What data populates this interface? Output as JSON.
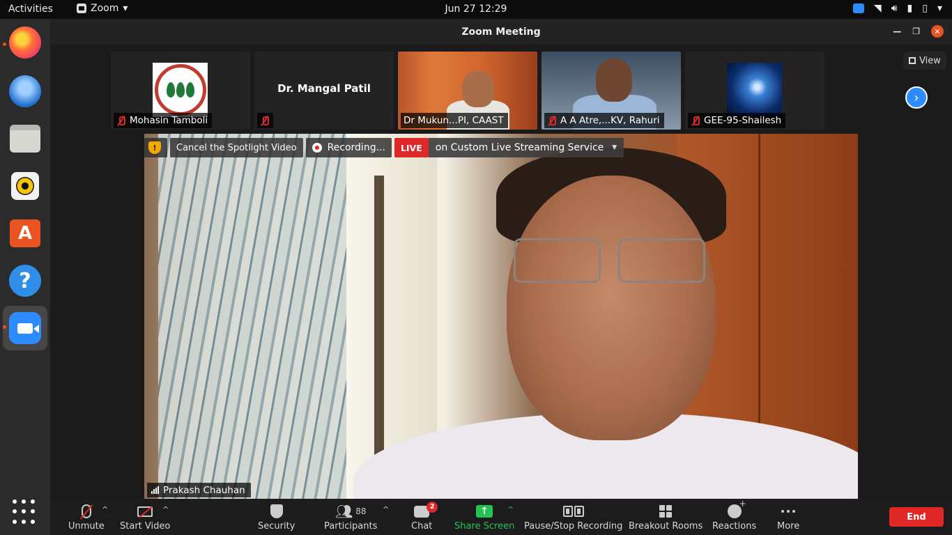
{
  "system_bar": {
    "activities": "Activities",
    "app_name": "Zoom",
    "clock": "Jun 27  12:29"
  },
  "window": {
    "title": "Zoom Meeting",
    "view_label": "View"
  },
  "participants_strip": [
    {
      "name": "Mohasin Tamboli",
      "muted": true,
      "kind": "logo"
    },
    {
      "name": "Dr. Mangal Patil",
      "muted": true,
      "kind": "name-only",
      "display_name": "Dr. Mangal Patil"
    },
    {
      "name": "Dr Mukun...PI, CAAST",
      "muted": true,
      "kind": "video"
    },
    {
      "name": "A A Atre,...KV, Rahuri",
      "muted": true,
      "kind": "video"
    },
    {
      "name": "GEE-95-Shailesh",
      "muted": true,
      "kind": "image"
    }
  ],
  "spotlight": {
    "cancel_label": "Cancel the Spotlight Video",
    "recording_label": "Recording...",
    "live_badge": "LIVE",
    "live_service": "on Custom Live Streaming Service",
    "active_speaker": "Prakash Chauhan"
  },
  "toolbar": {
    "unmute": "Unmute",
    "start_video": "Start Video",
    "security": "Security",
    "participants": "Participants",
    "participant_count": "88",
    "chat": "Chat",
    "chat_badge": "2",
    "share_screen": "Share Screen",
    "pause_recording": "Pause/Stop Recording",
    "breakout_rooms": "Breakout Rooms",
    "reactions": "Reactions",
    "more": "More",
    "end": "End"
  },
  "colors": {
    "zoom_blue": "#2d8cff",
    "end_red": "#e02828",
    "share_green": "#23c552",
    "ubuntu_orange": "#e95420"
  }
}
